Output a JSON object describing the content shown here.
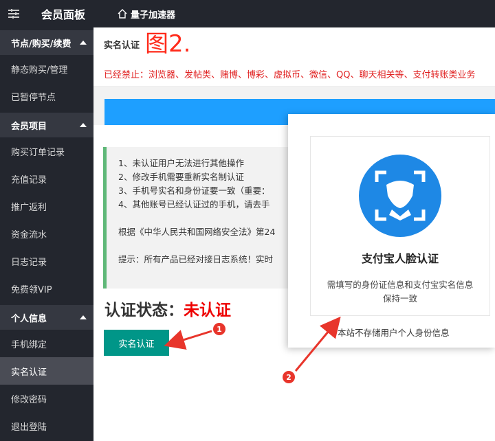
{
  "topbar": {
    "menu_icon": "menu-icon",
    "app_title": "会员面板",
    "home_icon": "home-icon",
    "home_label": "量子加速器"
  },
  "sidebar": {
    "groups": [
      {
        "label": "节点/购买/续费",
        "items": [
          "静态购买/管理",
          "已暂停节点"
        ]
      },
      {
        "label": "会员项目",
        "items": [
          "购买订单记录",
          "充值记录",
          "推广返利",
          "资金流水",
          "日志记录",
          "免费领VIP"
        ]
      },
      {
        "label": "个人信息",
        "items": [
          "手机绑定",
          "实名认证",
          "修改密码",
          "退出登陆"
        ]
      }
    ],
    "active_item": "实名认证"
  },
  "header": {
    "title": "实名认证",
    "figure_label": "图2."
  },
  "banned_text": "已经禁止：浏览器、发帖类、赌博、博彩、虚拟币、微信、QQ、聊天相关等、支付转账类业务",
  "notice": {
    "lines": [
      "1、未认证用户无法进行其他操作",
      "2、修改手机需要重新实名制认证",
      "3、手机号实名和身份证要一致（重要：",
      "4、其他账号已经认证过的手机，请去手"
    ],
    "law_line": "根据《中华人民共和国网络安全法》第24",
    "tip_line": "提示：所有产品已经对接日志系统！实时"
  },
  "status": {
    "label": "认证状态：",
    "value": "未认证"
  },
  "verify_button": "实名认证",
  "popup": {
    "card_title": "支付宝人脸认证",
    "card_desc": "需填写的身份证信息和支付宝实名信息保持一致",
    "footer": "本站不存储用户个人身份信息"
  },
  "annotations": {
    "badge_1": "1",
    "badge_2": "2"
  },
  "colors": {
    "sidebar_bg": "#23262e",
    "accent_teal": "#009688",
    "blue_bar": "#1e9fff",
    "alert_red": "#e02020",
    "face_blue": "#1e88e5"
  }
}
